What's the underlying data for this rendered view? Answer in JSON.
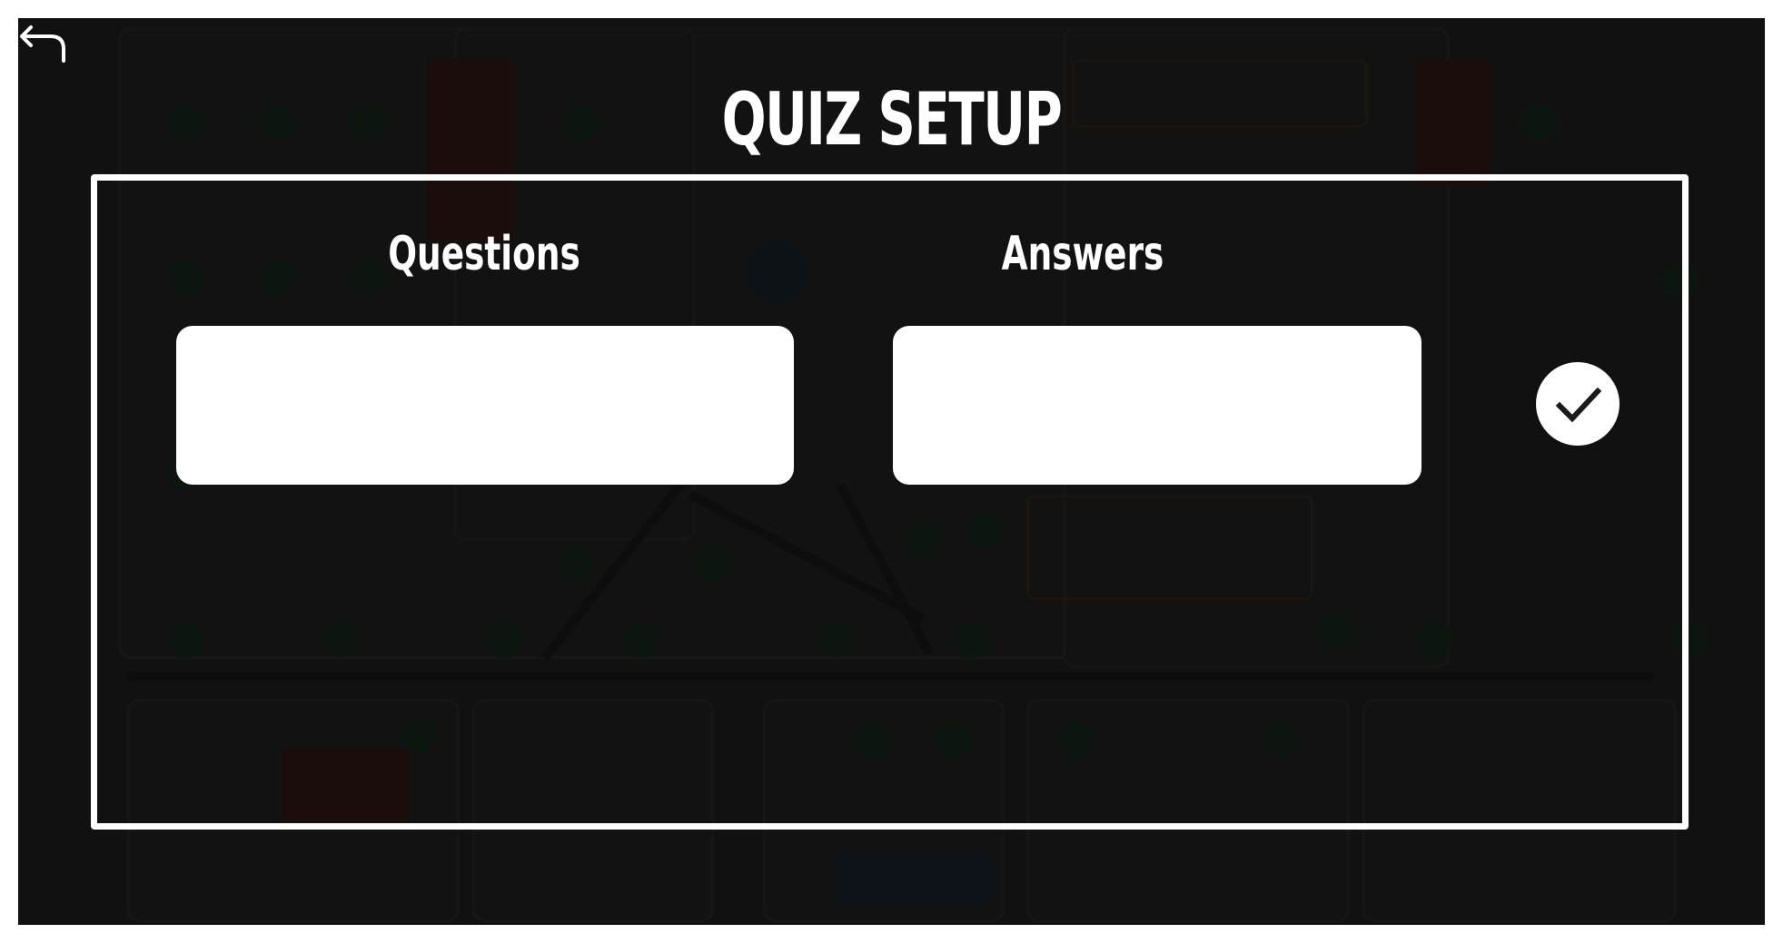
{
  "screen": {
    "title": "QUIZ SETUP"
  },
  "back_button": {
    "icon": "back-arrow-icon"
  },
  "quiz_form": {
    "questions_label": "Questions",
    "answers_label": "Answers",
    "question_input": {
      "value": "",
      "placeholder": ""
    },
    "answer_input": {
      "value": "",
      "placeholder": ""
    },
    "confirm_button": {
      "icon": "checkmark-icon"
    }
  },
  "colors": {
    "background": "#1b1b1b",
    "foreground": "#ffffff",
    "icon": "#1b1b1b"
  }
}
